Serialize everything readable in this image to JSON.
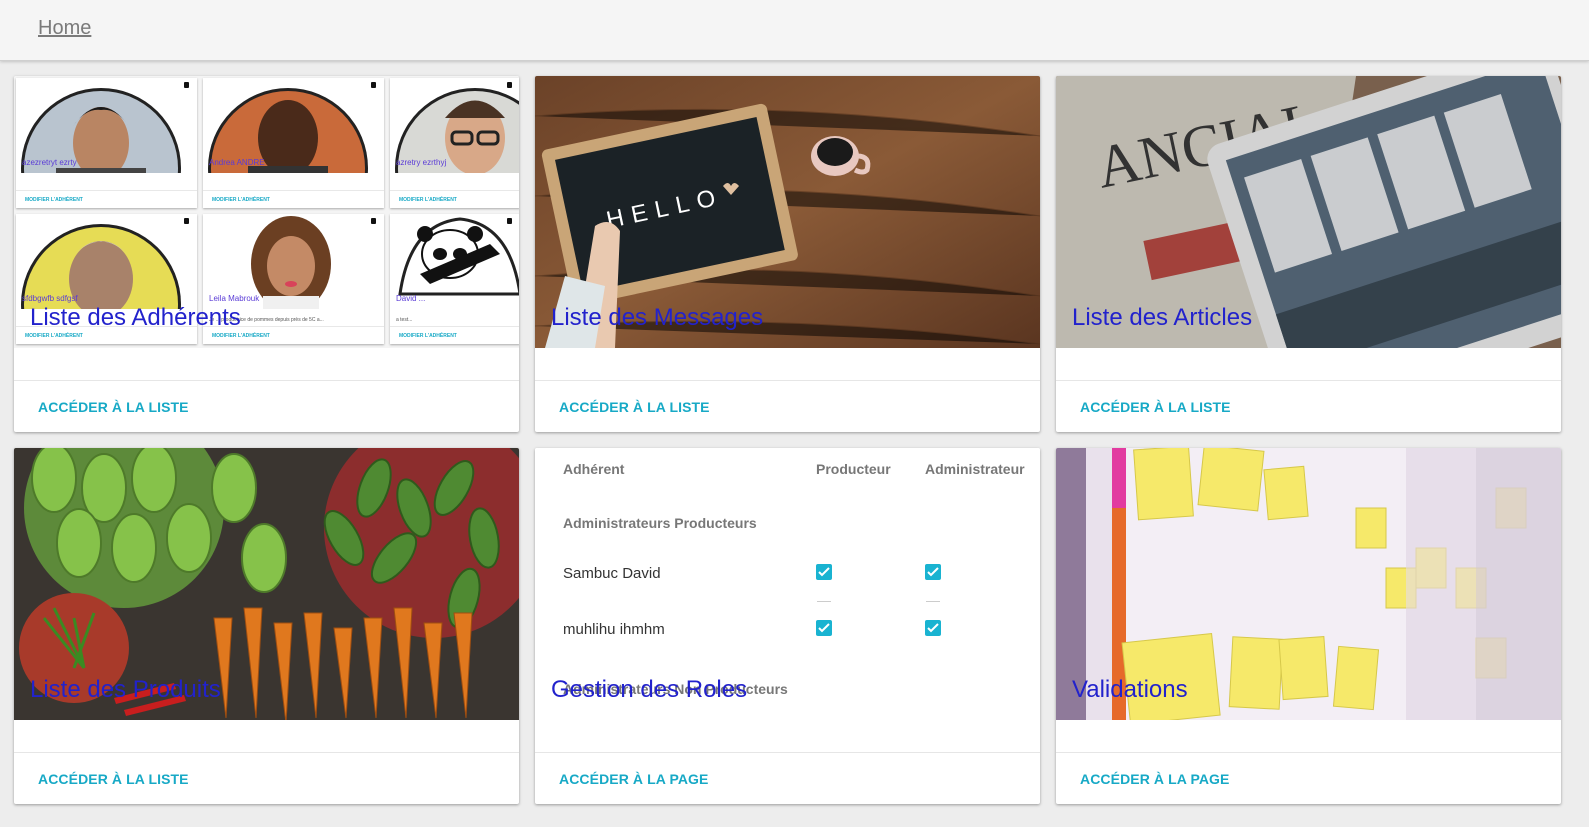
{
  "toolbar": {
    "home_link": "Home"
  },
  "cards": [
    {
      "title": "Liste des Adhérents",
      "action": "ACCÉDER À LA LISTE"
    },
    {
      "title": "Liste des Messages",
      "action": "ACCÉDER À LA LISTE"
    },
    {
      "title": "Liste des Articles",
      "action": "ACCÉDER À LA LISTE"
    },
    {
      "title": "Liste des Produits",
      "action": "ACCÉDER À LA LISTE"
    },
    {
      "title": "Gestion des Roles",
      "action": "ACCÉDER À LA PAGE"
    },
    {
      "title": "Validations",
      "action": "ACCÉDER À LA PAGE"
    }
  ],
  "members_preview": [
    {
      "name": "azezretryt ezrty",
      "desc": "...",
      "button": "MODIFIER L'ADHÉRENT"
    },
    {
      "name": "Andrea ANDRE",
      "desc": "...",
      "button": "MODIFIER L'ADHÉRENT"
    },
    {
      "name": "azretry ezrthyj",
      "desc": "...",
      "button": "MODIFIER L'ADHÉRENT"
    },
    {
      "name": "sfdbgwfb sdfgsf",
      "desc": "...",
      "button": "MODIFIER L'ADHÉRENT"
    },
    {
      "name": "Leila Mabrouk",
      "desc": "Je ... productrice de pommes depuis près de 5C a...",
      "button": "MODIFIER L'ADHÉRENT"
    },
    {
      "name": "David ...",
      "desc": "a test...",
      "button": "MODIFIER L'ADHÉRENT"
    }
  ],
  "roles_preview": {
    "headers": {
      "member": "Adhérent",
      "producer": "Producteur",
      "admin": "Administrateur"
    },
    "section_1": "Administrateurs Producteurs",
    "rows": [
      {
        "name": "Sambuc David",
        "producer": true,
        "admin": true
      },
      {
        "name": "muhlihu ihmhm",
        "producer": true,
        "admin": true
      }
    ],
    "section_2": "Administrateurs Non Producteurs"
  },
  "hello_letters": "HELLO",
  "colors": {
    "accent": "#17a9c6",
    "title": "#2222cc",
    "checkbox": "#19b3d1"
  }
}
